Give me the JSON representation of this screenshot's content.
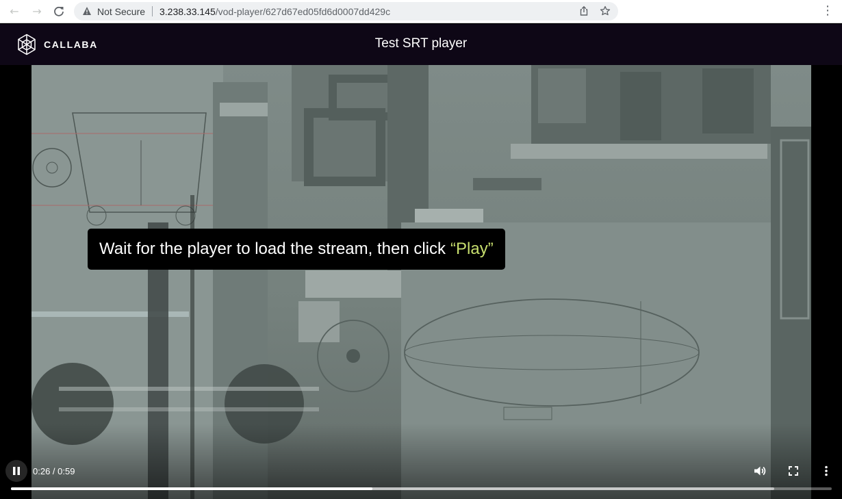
{
  "browser": {
    "security_label": "Not Secure",
    "url_host": "3.238.33.145",
    "url_path": "/vod-player/627d67ed05fd6d0007dd429c",
    "icons": [
      "back-arrow-icon",
      "forward-arrow-icon",
      "reload-icon",
      "warning-icon",
      "share-icon",
      "bookmark-star-icon",
      "menu-dots-icon"
    ]
  },
  "app": {
    "brand": "CALLABA",
    "title": "Test SRT player"
  },
  "overlay": {
    "message": "Wait for the player to load the stream, then click",
    "highlight": "“Play”",
    "highlight_color": "#c8df6e"
  },
  "player": {
    "time_display": "0:26 / 0:59",
    "progress_fraction": 0.44,
    "buffered_fraction": 0.93,
    "state": "playing",
    "icons": [
      "pause-icon",
      "volume-icon",
      "fullscreen-icon",
      "more-options-icon"
    ]
  },
  "colors": {
    "header_bg": "#0e0716",
    "accent": "#c8df6e"
  }
}
